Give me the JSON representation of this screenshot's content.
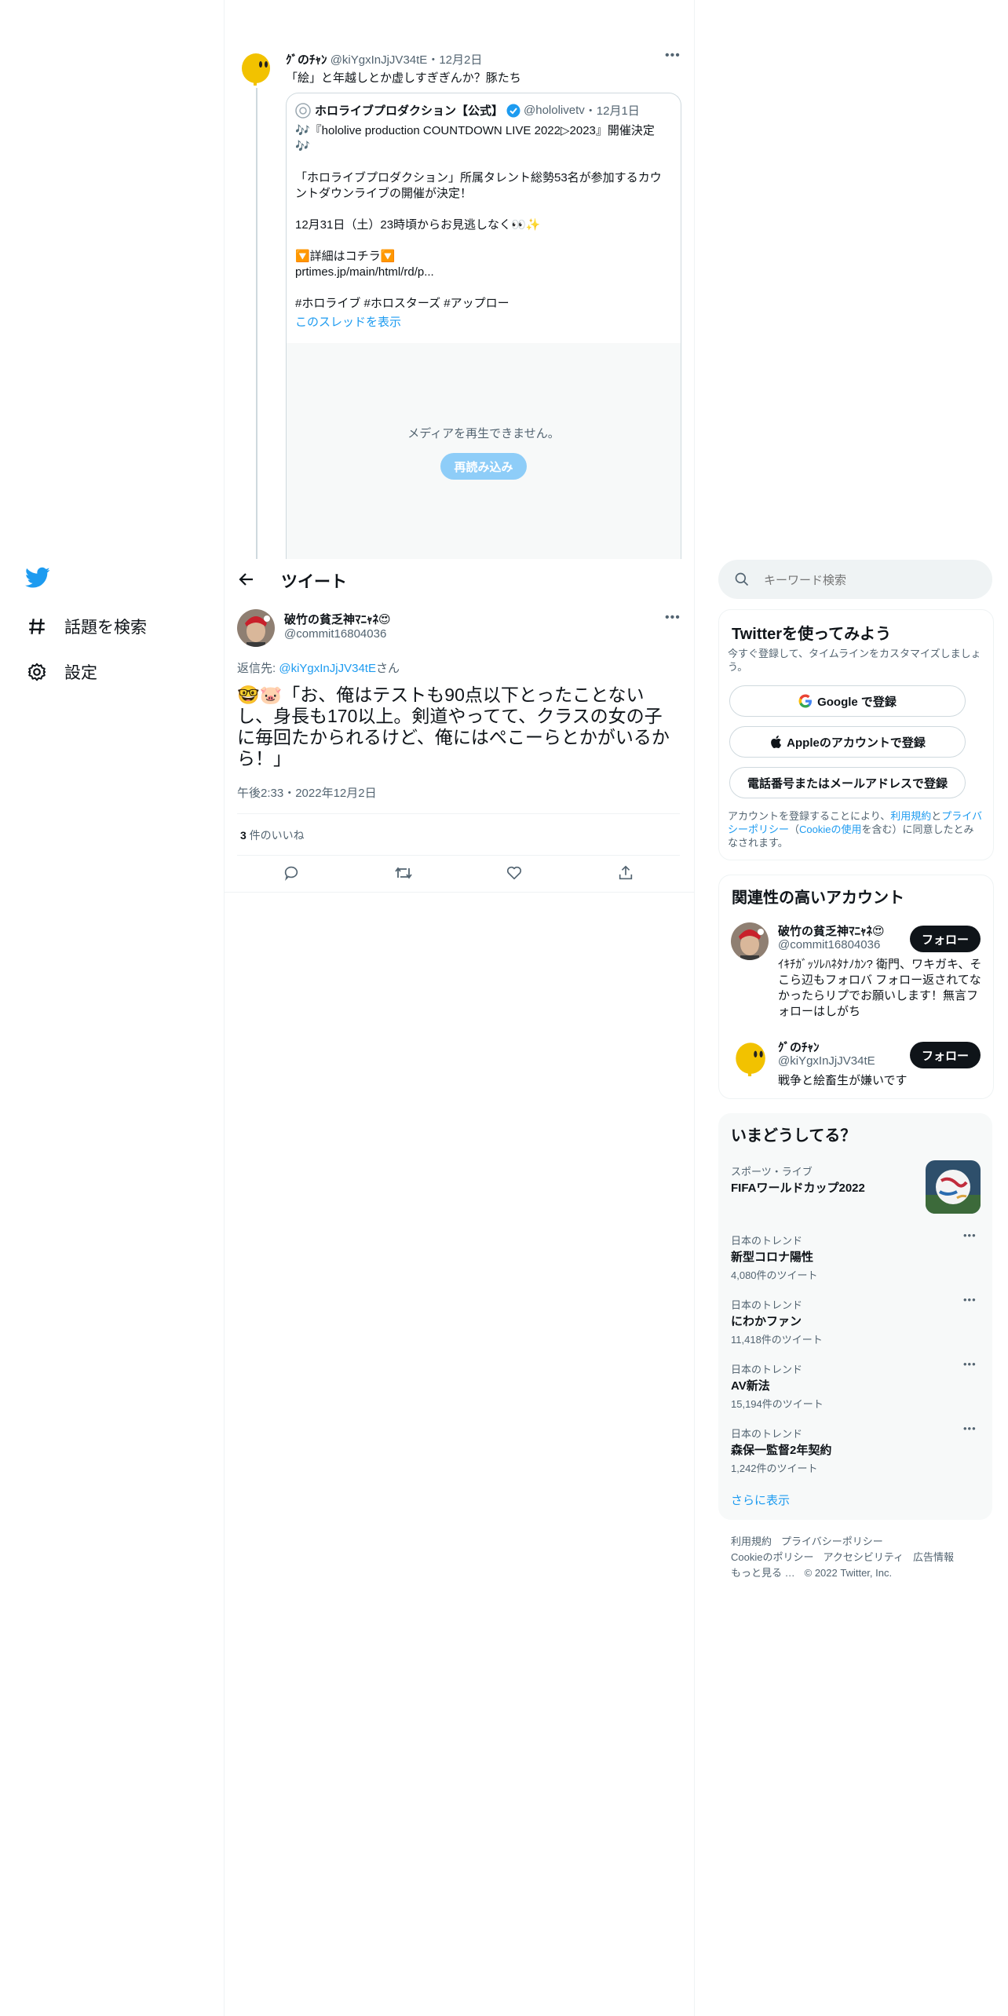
{
  "colors": {
    "accent": "#1d9bf0",
    "text": "#0f1419",
    "muted": "#536471",
    "border": "#eff3f4",
    "follow_bg": "#0f1419"
  },
  "quoted_parent": {
    "author_name": "ｸﾞのﾁｬﾝ",
    "author_handle": "@kiYgxInJjJV34tE",
    "date": "・12月2日",
    "text": "「絵」と年越しとか虚しすぎぎんか？豚たち",
    "quote": {
      "org_name": "ホロライブプロダクション【公式】",
      "org_handle": "@hololivetv",
      "org_date": "・12月1日",
      "line1": "🎶『hololive production COUNTDOWN LIVE 2022▷2023』開催決定",
      "line1b": "🎶",
      "line2": "「ホロライブプロダクション」所属タレント総勢53名が参加するカウントダウンライブの開催が決定！",
      "line3": "12月31日（土）23時頃からお見逃しなく👀✨",
      "line4": "🔽詳細はコチラ🔽",
      "line5": "prtimes.jp/main/html/rd/p...",
      "line6": "#ホロライブ #ホロスターズ #アップロー",
      "thread_link": "このスレッドを表示",
      "media_error": "メディアを再生できません。",
      "reload_label": "再読み込み"
    }
  },
  "nav": {
    "explore_label": "話題を検索",
    "settings_label": "設定"
  },
  "header": {
    "title": "ツイート"
  },
  "main_tweet": {
    "author_name": "破竹の貧乏神ﾏﾆｬﾈ😍",
    "author_handle": "@commit16804036",
    "reply_prefix": "返信先: ",
    "reply_handle": "@kiYgxInJjJV34tE",
    "reply_suffix": "さん",
    "text": "🤓🐷「お、俺はテストも90点以下とったことないし、身長も170以上。剣道やってて、クラスの女の子に毎回たかられるけど、俺にはぺこーらとかがいるから！」",
    "timestamp": "午後2:33・2022年12月2日",
    "likes_count": "3",
    "likes_label": " 件のいいね"
  },
  "search": {
    "placeholder": "キーワード検索"
  },
  "signup": {
    "title": "Twitterを使ってみよう",
    "subtitle": "今すぐ登録して、タイムラインをカスタマイズしましょう。",
    "google_label": "Google で登録",
    "apple_label": "Appleのアカウントで登録",
    "phone_label": "電話番号またはメールアドレスで登録",
    "terms_pre": "アカウントを登録することにより、",
    "terms_link1": "利用規約",
    "terms_mid": "と",
    "terms_link2": "プライバシーポリシー",
    "terms_paren_open": "（",
    "terms_link3": "Cookieの使用",
    "terms_post": "を含む）に同意したとみなされます。"
  },
  "related": {
    "title": "関連性の高いアカウント",
    "accounts": [
      {
        "name": "破竹の貧乏神ﾏﾆｬﾈ😍",
        "handle": "@commit16804036",
        "bio": "ｲｷﾁｶﾞｯｿﾚﾊﾈﾀﾅﾉｶﾝ? 衛門、ワキガキ、そこら辺もフォロバ フォロー返されてなかったらリプでお願いします！無言フォローはしがち",
        "follow_label": "フォロー"
      },
      {
        "name": "ｸﾞのﾁｬﾝ",
        "handle": "@kiYgxInJjJV34tE",
        "bio": "戦争と絵畜生が嫌いです",
        "follow_label": "フォロー"
      }
    ]
  },
  "trends": {
    "title": "いまどうしてる？",
    "featured": {
      "category": "スポーツ・ライブ",
      "title": "FIFAワールドカップ2022"
    },
    "items": [
      {
        "label": "日本のトレンド",
        "title": "新型コロナ陽性",
        "count": "4,080件のツイート"
      },
      {
        "label": "日本のトレンド",
        "title": "にわかファン",
        "count": "11,418件のツイート"
      },
      {
        "label": "日本のトレンド",
        "title": "AV新法",
        "count": "15,194件のツイート"
      },
      {
        "label": "日本のトレンド",
        "title": "森保一監督2年契約",
        "count": "1,242件のツイート"
      }
    ],
    "more_label": "さらに表示"
  },
  "footer": {
    "terms": "利用規約",
    "privacy": "プライバシーポリシー",
    "cookie": "Cookieのポリシー",
    "accessibility": "アクセシビリティ",
    "ads": "広告情報",
    "more": "もっと見る …",
    "copyright": "© 2022 Twitter, Inc."
  }
}
